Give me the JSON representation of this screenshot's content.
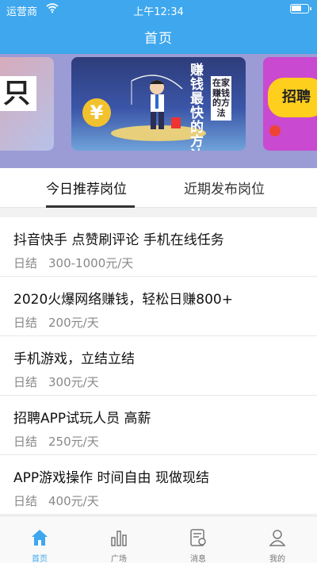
{
  "status_bar": {
    "carrier": "运营商",
    "time": "上午12:34"
  },
  "header": {
    "title": "首页"
  },
  "banner": {
    "left_slide_text": "只",
    "center_slide": {
      "big_text": "赚钱最快的方法",
      "sub_text": "在家赚钱的方法"
    },
    "right_slide_text": "招聘"
  },
  "tabs": [
    {
      "label": "今日推荐岗位",
      "active": true
    },
    {
      "label": "近期发布岗位",
      "active": false
    }
  ],
  "jobs": [
    {
      "title": "抖音快手 点赞刷评论 手机在线任务",
      "settle": "日结",
      "pay": "300-1000元/天"
    },
    {
      "title": "2020火爆网络赚钱，轻松日赚800+",
      "settle": "日结",
      "pay": "200元/天"
    },
    {
      "title": "手机游戏，立结立结",
      "settle": "日结",
      "pay": "300元/天"
    },
    {
      "title": "招聘APP试玩人员 高薪",
      "settle": "日结",
      "pay": "250元/天"
    },
    {
      "title": "APP游戏操作 时间自由 现做现结",
      "settle": "日结",
      "pay": "400元/天"
    }
  ],
  "tabbar": [
    {
      "label": "首页",
      "icon": "home-icon",
      "active": true
    },
    {
      "label": "广场",
      "icon": "chart-icon",
      "active": false
    },
    {
      "label": "消息",
      "icon": "message-icon",
      "active": false
    },
    {
      "label": "我的",
      "icon": "user-icon",
      "active": false
    }
  ],
  "colors": {
    "primary": "#3ea7ee",
    "tab_underline": "#333333",
    "muted_text": "#888888"
  }
}
